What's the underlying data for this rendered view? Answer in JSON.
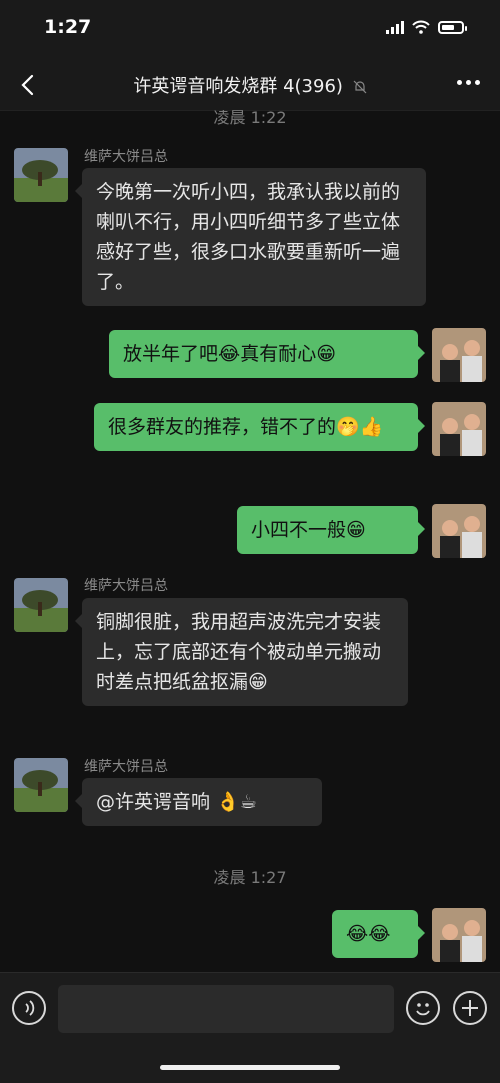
{
  "status_bar": {
    "time": "1:27"
  },
  "nav": {
    "title": "许英谔音响发烧群 4(396)"
  },
  "timestamps": [
    "凌晨 1:22",
    "凌晨 1:27"
  ],
  "messages": [
    {
      "side": "recv",
      "sender": "维萨大饼吕总",
      "text": "今晚第一次听小四，我承认我以前的喇叭不行，用小四听细节多了些立体感好了些，很多口水歌要重新听一遍了。"
    },
    {
      "side": "sent",
      "text": "放半年了吧😂真有耐心😁"
    },
    {
      "side": "sent",
      "text": "很多群友的推荐，错不了的🤭👍"
    },
    {
      "side": "sent",
      "text": "小四不一般😁"
    },
    {
      "side": "recv",
      "sender": "维萨大饼吕总",
      "text": "铜脚很脏，我用超声波洗完才安装上，忘了底部还有个被动单元搬动时差点把纸盆抠漏😁"
    },
    {
      "side": "recv",
      "sender": "维萨大饼吕总",
      "text": "@许英谔音响 👌☕"
    },
    {
      "side": "sent",
      "text": "😂😂"
    }
  ],
  "input": {
    "placeholder": ""
  },
  "colors": {
    "sent_bubble": "#58be6a",
    "recv_bubble": "#2c2c2c",
    "background": "#111111"
  },
  "icons": [
    "back-arrow-icon",
    "mute-bell-icon",
    "more-dots-icon",
    "voice-icon",
    "emoji-icon",
    "plus-icon"
  ]
}
